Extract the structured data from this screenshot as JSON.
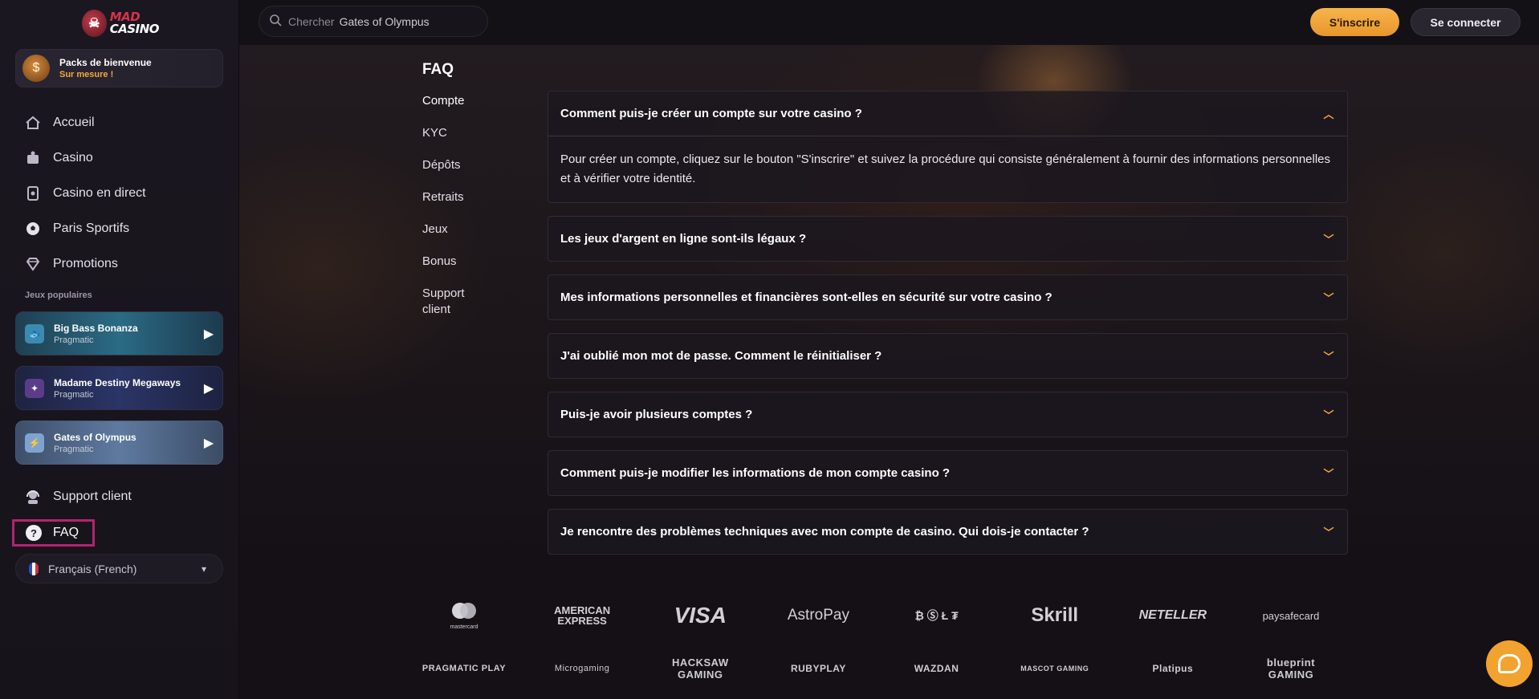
{
  "brand": {
    "logo_line1": "MAD",
    "logo_line2": "CASINO"
  },
  "welcome": {
    "title": "Packs de bienvenue",
    "subtitle": "Sur mesure !"
  },
  "nav": [
    {
      "label": "Accueil",
      "icon": "home-icon"
    },
    {
      "label": "Casino",
      "icon": "casino-icon"
    },
    {
      "label": "Casino en direct",
      "icon": "live-casino-icon"
    },
    {
      "label": "Paris Sportifs",
      "icon": "soccer-ball-icon"
    },
    {
      "label": "Promotions",
      "icon": "diamond-icon"
    }
  ],
  "popular": {
    "label": "Jeux populaires",
    "games": [
      {
        "title": "Big Bass Bonanza",
        "provider": "Pragmatic"
      },
      {
        "title": "Madame Destiny Megaways",
        "provider": "Pragmatic"
      },
      {
        "title": "Gates of Olympus",
        "provider": "Pragmatic"
      }
    ]
  },
  "support_label": "Support client",
  "faq_label": "FAQ",
  "language": "Français (French)",
  "search": {
    "placeholder": "Chercher",
    "value": "Gates of Olympus"
  },
  "header": {
    "signup": "S'inscrire",
    "login": "Se connecter"
  },
  "faq": {
    "title": "FAQ",
    "categories": [
      "Compte",
      "KYC",
      "Dépôts",
      "Retraits",
      "Jeux",
      "Bonus",
      "Support client"
    ],
    "items": [
      {
        "question": "Comment puis-je créer un compte sur votre casino ?",
        "answer": "Pour créer un compte, cliquez sur le bouton \"S'inscrire\" et suivez la procédure qui consiste généralement à fournir des informations personnelles et à vérifier votre identité.",
        "open": true
      },
      {
        "question": "Les jeux d'argent en ligne sont-ils légaux ?",
        "open": false
      },
      {
        "question": "Mes informations personnelles et financières sont-elles en sécurité sur votre casino ?",
        "open": false
      },
      {
        "question": "J'ai oublié mon mot de passe. Comment le réinitialiser ?",
        "open": false
      },
      {
        "question": "Puis-je avoir plusieurs comptes ?",
        "open": false
      },
      {
        "question": "Comment puis-je modifier les informations de mon compte casino ?",
        "open": false
      },
      {
        "question": "Je rencontre des problèmes techniques avec mon compte de casino. Qui dois-je contacter ?",
        "open": false
      }
    ]
  },
  "payment_logos": [
    "mastercard",
    "AMERICAN EXPRESS",
    "VISA",
    "AstroPay",
    "₿ Ⓢ Ł ₮",
    "Skrill",
    "NETELLER",
    "paysafecard"
  ],
  "provider_logos": [
    "PRAGMATIC PLAY",
    "Microgaming",
    "HACKSAW GAMING",
    "RUBYPLAY",
    "WAZDAN",
    "MASCOT GAMING",
    "Platipus",
    "blueprint GAMING"
  ],
  "colors": {
    "accent": "#f2a93b",
    "highlight_border": "#b3236f",
    "background": "#141016"
  }
}
